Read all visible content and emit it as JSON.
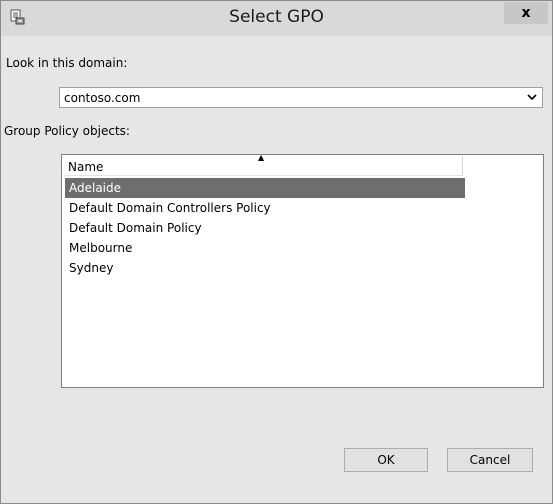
{
  "window": {
    "title": "Select GPO",
    "app_icon": "gpmc-icon",
    "close_label": "x"
  },
  "domain": {
    "label": "Look in this domain:",
    "selected": "contoso.com"
  },
  "gpo_list": {
    "label": "Group Policy objects:",
    "column_header": "Name",
    "sort": "ascending",
    "items": [
      {
        "name": "Adelaide",
        "selected": true
      },
      {
        "name": "Default Domain Controllers Policy",
        "selected": false
      },
      {
        "name": "Default Domain Policy",
        "selected": false
      },
      {
        "name": "Melbourne",
        "selected": false
      },
      {
        "name": "Sydney",
        "selected": false
      }
    ]
  },
  "buttons": {
    "ok": "OK",
    "cancel": "Cancel"
  },
  "colors": {
    "titlebar": "#d9d9d9",
    "dialog_bg": "#e6e6e6",
    "selection": "#6e6e6e",
    "close_button": "#c7c7c7"
  }
}
